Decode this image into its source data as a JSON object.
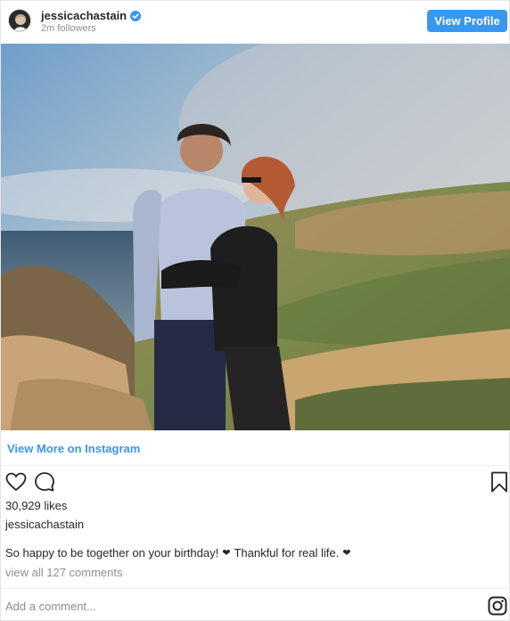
{
  "header": {
    "username": "jessicachastain",
    "followers": "2m followers",
    "view_profile_label": "View Profile",
    "avatar_icon": "profile-avatar",
    "verified_icon": "verified-badge-icon"
  },
  "post": {
    "photo_alt": "Two people embracing on a coastal hillside above the ocean",
    "view_more_label": "View More on Instagram",
    "likes": "30,929 likes",
    "owner": "jessicachastain",
    "caption_part1": "So happy to be together on your birthday!",
    "caption_heart1": "❤",
    "caption_part2": "Thankful for real life.",
    "caption_heart2": "❤",
    "view_comments": "view all 127 comments"
  },
  "actions": {
    "like_icon": "heart-icon",
    "comment_icon": "comment-icon",
    "save_icon": "bookmark-icon"
  },
  "comment": {
    "placeholder": "Add a comment...",
    "instagram_icon": "instagram-icon"
  },
  "colors": {
    "accent": "#3897f0",
    "text": "#262626",
    "muted": "#8e8e8e"
  }
}
